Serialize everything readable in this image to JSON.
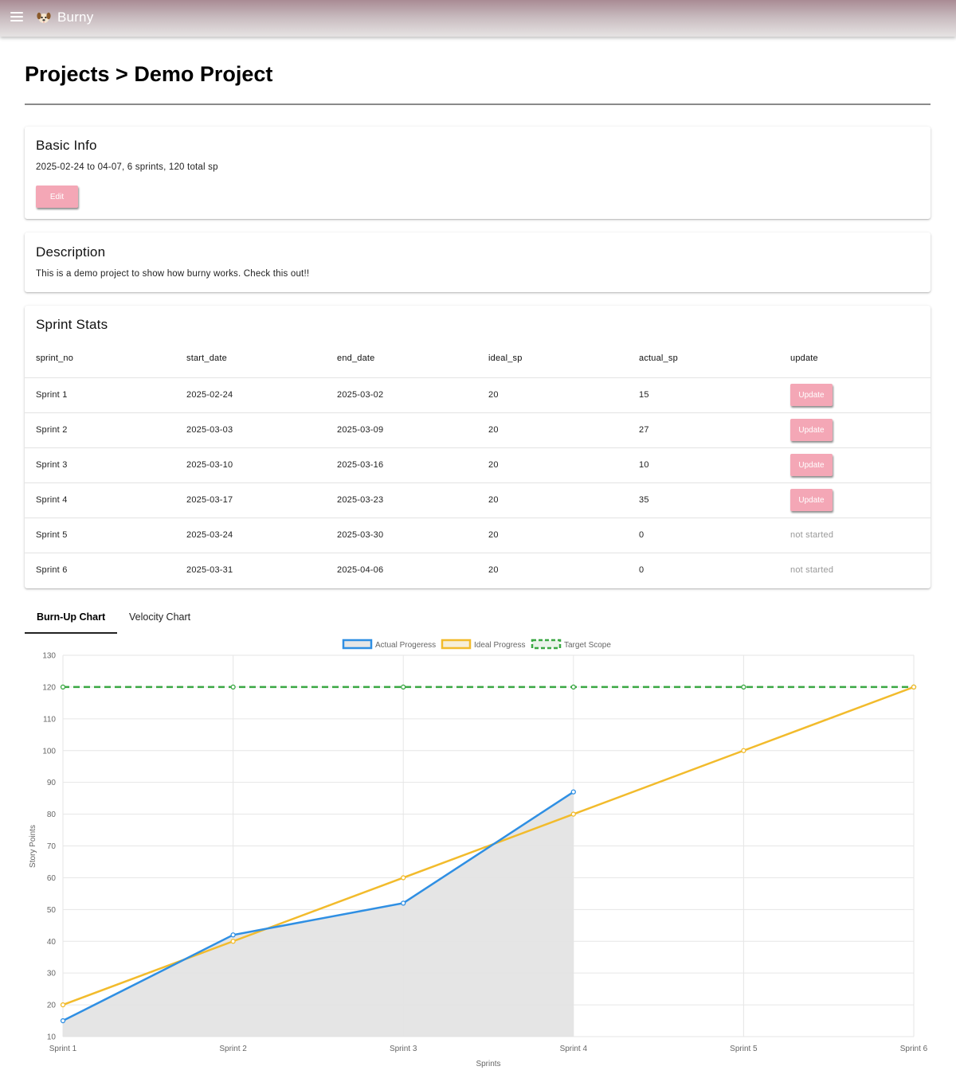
{
  "app": {
    "title": "Burny"
  },
  "page": {
    "title": "Projects > Demo Project"
  },
  "basic_info": {
    "heading": "Basic Info",
    "summary": "2025-02-24 to 04-07, 6 sprints, 120 total sp",
    "edit_label": "Edit"
  },
  "description": {
    "heading": "Description",
    "text": "This is a demo project to show how burny works. Check this out!!"
  },
  "sprint_stats": {
    "heading": "Sprint Stats",
    "columns": [
      "sprint_no",
      "start_date",
      "end_date",
      "ideal_sp",
      "actual_sp",
      "update"
    ],
    "rows": [
      {
        "sprint_no": "Sprint 1",
        "start_date": "2025-02-24",
        "end_date": "2025-03-02",
        "ideal_sp": "20",
        "actual_sp": "15",
        "update": "Update"
      },
      {
        "sprint_no": "Sprint 2",
        "start_date": "2025-03-03",
        "end_date": "2025-03-09",
        "ideal_sp": "20",
        "actual_sp": "27",
        "update": "Update"
      },
      {
        "sprint_no": "Sprint 3",
        "start_date": "2025-03-10",
        "end_date": "2025-03-16",
        "ideal_sp": "20",
        "actual_sp": "10",
        "update": "Update"
      },
      {
        "sprint_no": "Sprint 4",
        "start_date": "2025-03-17",
        "end_date": "2025-03-23",
        "ideal_sp": "20",
        "actual_sp": "35",
        "update": "Update"
      },
      {
        "sprint_no": "Sprint 5",
        "start_date": "2025-03-24",
        "end_date": "2025-03-30",
        "ideal_sp": "20",
        "actual_sp": "0",
        "update": "not started"
      },
      {
        "sprint_no": "Sprint 6",
        "start_date": "2025-03-31",
        "end_date": "2025-04-06",
        "ideal_sp": "20",
        "actual_sp": "0",
        "update": "not started"
      }
    ]
  },
  "tabs": [
    {
      "label": "Burn-Up Chart",
      "active": true
    },
    {
      "label": "Velocity Chart",
      "active": false
    }
  ],
  "colors": {
    "pink": "#f4a7b6",
    "actual": "#2f8fe3",
    "ideal": "#f2bb2c",
    "target": "#3aa843",
    "area_fill": "#e4e4e4",
    "grid": "#e6e6e6"
  },
  "chart_data": {
    "type": "line",
    "categories": [
      "Sprint 1",
      "Sprint 2",
      "Sprint 3",
      "Sprint 4",
      "Sprint 5",
      "Sprint 6"
    ],
    "series": [
      {
        "name": "Actual Progeress",
        "values": [
          15,
          42,
          52,
          87,
          null,
          null
        ],
        "fill": true
      },
      {
        "name": "Ideal Progress",
        "values": [
          20,
          40,
          60,
          80,
          100,
          120
        ]
      },
      {
        "name": "Target Scope",
        "values": [
          120,
          120,
          120,
          120,
          120,
          120
        ],
        "dashed": true
      }
    ],
    "xlabel": "Sprints",
    "ylabel": "Story Points",
    "ylim": [
      10,
      130
    ],
    "yticks": [
      10,
      20,
      30,
      40,
      50,
      60,
      70,
      80,
      90,
      100,
      110,
      120,
      130
    ],
    "grid": true,
    "legend": "top-center"
  }
}
